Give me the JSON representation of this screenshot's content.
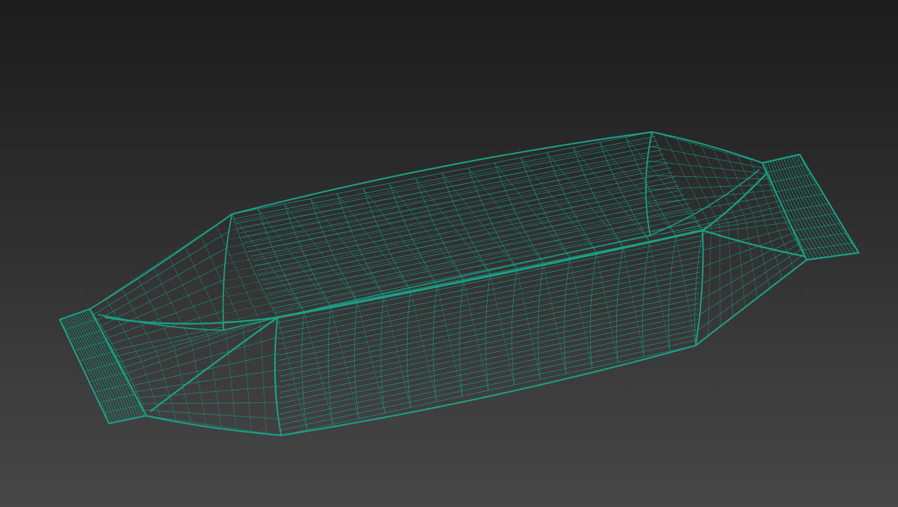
{
  "viewport": {
    "mode": "wireframe",
    "background_top_color": "#1c1c1c",
    "background_bottom_color": "#474747",
    "wire_color": "#1aa085",
    "wire_dense_color": "#14886f"
  },
  "object": {
    "shape": "candy-wrapper"
  }
}
